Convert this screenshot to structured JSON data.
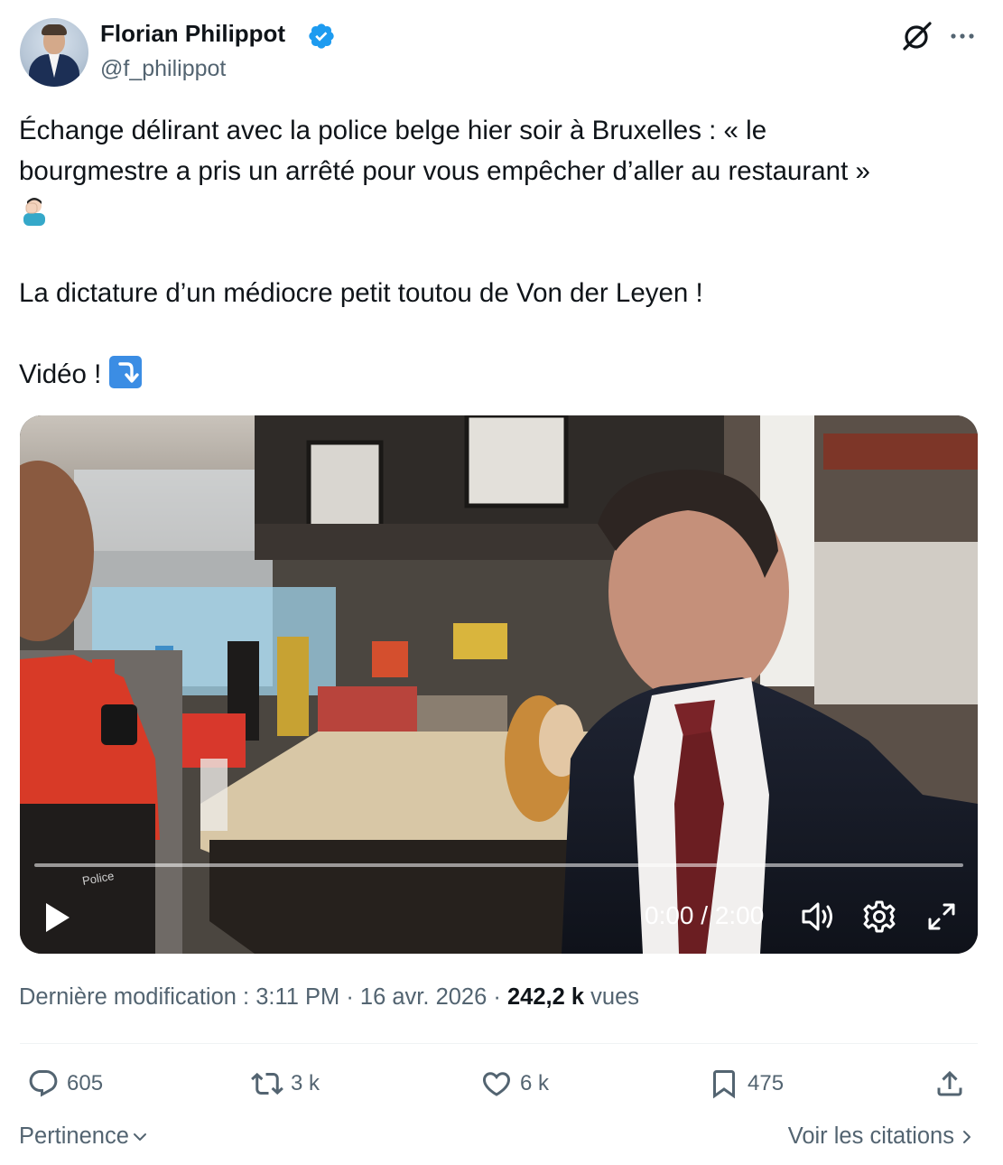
{
  "author": {
    "name": "Florian Philippot",
    "handle": "@f_philippot"
  },
  "tweet": {
    "text_line1": "Échange délirant avec la police belge hier soir à Bruxelles : « le",
    "text_line2": "bourgmestre a pris un arrêté pour vous empêcher d’aller au restaurant »",
    "text_line3": "La dictature d’un médiocre petit toutou de Von der Leyen !",
    "text_line4": "Vidéo ! "
  },
  "video": {
    "time": "0:00 / 2:00",
    "progress": 0,
    "vest_text": "Police"
  },
  "meta": {
    "prefix": "Dernière modification : 3:11 PM · 16 avr. 2026 · ",
    "views_count": "242,2 k",
    "views_label": " vues"
  },
  "actions": {
    "replies": "605",
    "reposts": "3 k",
    "likes": "6 k",
    "bookmarks": "475"
  },
  "footer": {
    "sort_label": "Pertinence",
    "quotes_label": "Voir les citations"
  },
  "colors": {
    "verified": "#1d9bf0",
    "secondary_text": "#536471",
    "primary_text": "#0f1419"
  }
}
